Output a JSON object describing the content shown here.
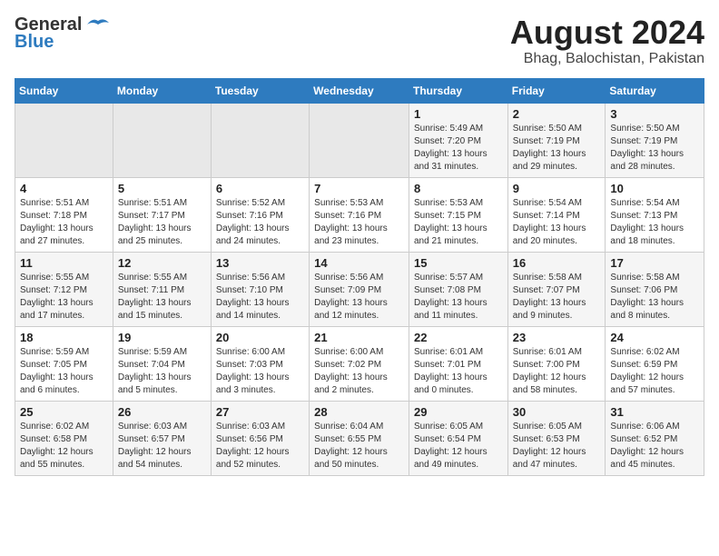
{
  "logo": {
    "line1": "General",
    "line2": "Blue"
  },
  "title": "August 2024",
  "subtitle": "Bhag, Balochistan, Pakistan",
  "days_of_week": [
    "Sunday",
    "Monday",
    "Tuesday",
    "Wednesday",
    "Thursday",
    "Friday",
    "Saturday"
  ],
  "weeks": [
    [
      {
        "num": "",
        "info": ""
      },
      {
        "num": "",
        "info": ""
      },
      {
        "num": "",
        "info": ""
      },
      {
        "num": "",
        "info": ""
      },
      {
        "num": "1",
        "info": "Sunrise: 5:49 AM\nSunset: 7:20 PM\nDaylight: 13 hours\nand 31 minutes."
      },
      {
        "num": "2",
        "info": "Sunrise: 5:50 AM\nSunset: 7:19 PM\nDaylight: 13 hours\nand 29 minutes."
      },
      {
        "num": "3",
        "info": "Sunrise: 5:50 AM\nSunset: 7:19 PM\nDaylight: 13 hours\nand 28 minutes."
      }
    ],
    [
      {
        "num": "4",
        "info": "Sunrise: 5:51 AM\nSunset: 7:18 PM\nDaylight: 13 hours\nand 27 minutes."
      },
      {
        "num": "5",
        "info": "Sunrise: 5:51 AM\nSunset: 7:17 PM\nDaylight: 13 hours\nand 25 minutes."
      },
      {
        "num": "6",
        "info": "Sunrise: 5:52 AM\nSunset: 7:16 PM\nDaylight: 13 hours\nand 24 minutes."
      },
      {
        "num": "7",
        "info": "Sunrise: 5:53 AM\nSunset: 7:16 PM\nDaylight: 13 hours\nand 23 minutes."
      },
      {
        "num": "8",
        "info": "Sunrise: 5:53 AM\nSunset: 7:15 PM\nDaylight: 13 hours\nand 21 minutes."
      },
      {
        "num": "9",
        "info": "Sunrise: 5:54 AM\nSunset: 7:14 PM\nDaylight: 13 hours\nand 20 minutes."
      },
      {
        "num": "10",
        "info": "Sunrise: 5:54 AM\nSunset: 7:13 PM\nDaylight: 13 hours\nand 18 minutes."
      }
    ],
    [
      {
        "num": "11",
        "info": "Sunrise: 5:55 AM\nSunset: 7:12 PM\nDaylight: 13 hours\nand 17 minutes."
      },
      {
        "num": "12",
        "info": "Sunrise: 5:55 AM\nSunset: 7:11 PM\nDaylight: 13 hours\nand 15 minutes."
      },
      {
        "num": "13",
        "info": "Sunrise: 5:56 AM\nSunset: 7:10 PM\nDaylight: 13 hours\nand 14 minutes."
      },
      {
        "num": "14",
        "info": "Sunrise: 5:56 AM\nSunset: 7:09 PM\nDaylight: 13 hours\nand 12 minutes."
      },
      {
        "num": "15",
        "info": "Sunrise: 5:57 AM\nSunset: 7:08 PM\nDaylight: 13 hours\nand 11 minutes."
      },
      {
        "num": "16",
        "info": "Sunrise: 5:58 AM\nSunset: 7:07 PM\nDaylight: 13 hours\nand 9 minutes."
      },
      {
        "num": "17",
        "info": "Sunrise: 5:58 AM\nSunset: 7:06 PM\nDaylight: 13 hours\nand 8 minutes."
      }
    ],
    [
      {
        "num": "18",
        "info": "Sunrise: 5:59 AM\nSunset: 7:05 PM\nDaylight: 13 hours\nand 6 minutes."
      },
      {
        "num": "19",
        "info": "Sunrise: 5:59 AM\nSunset: 7:04 PM\nDaylight: 13 hours\nand 5 minutes."
      },
      {
        "num": "20",
        "info": "Sunrise: 6:00 AM\nSunset: 7:03 PM\nDaylight: 13 hours\nand 3 minutes."
      },
      {
        "num": "21",
        "info": "Sunrise: 6:00 AM\nSunset: 7:02 PM\nDaylight: 13 hours\nand 2 minutes."
      },
      {
        "num": "22",
        "info": "Sunrise: 6:01 AM\nSunset: 7:01 PM\nDaylight: 13 hours\nand 0 minutes."
      },
      {
        "num": "23",
        "info": "Sunrise: 6:01 AM\nSunset: 7:00 PM\nDaylight: 12 hours\nand 58 minutes."
      },
      {
        "num": "24",
        "info": "Sunrise: 6:02 AM\nSunset: 6:59 PM\nDaylight: 12 hours\nand 57 minutes."
      }
    ],
    [
      {
        "num": "25",
        "info": "Sunrise: 6:02 AM\nSunset: 6:58 PM\nDaylight: 12 hours\nand 55 minutes."
      },
      {
        "num": "26",
        "info": "Sunrise: 6:03 AM\nSunset: 6:57 PM\nDaylight: 12 hours\nand 54 minutes."
      },
      {
        "num": "27",
        "info": "Sunrise: 6:03 AM\nSunset: 6:56 PM\nDaylight: 12 hours\nand 52 minutes."
      },
      {
        "num": "28",
        "info": "Sunrise: 6:04 AM\nSunset: 6:55 PM\nDaylight: 12 hours\nand 50 minutes."
      },
      {
        "num": "29",
        "info": "Sunrise: 6:05 AM\nSunset: 6:54 PM\nDaylight: 12 hours\nand 49 minutes."
      },
      {
        "num": "30",
        "info": "Sunrise: 6:05 AM\nSunset: 6:53 PM\nDaylight: 12 hours\nand 47 minutes."
      },
      {
        "num": "31",
        "info": "Sunrise: 6:06 AM\nSunset: 6:52 PM\nDaylight: 12 hours\nand 45 minutes."
      }
    ]
  ]
}
